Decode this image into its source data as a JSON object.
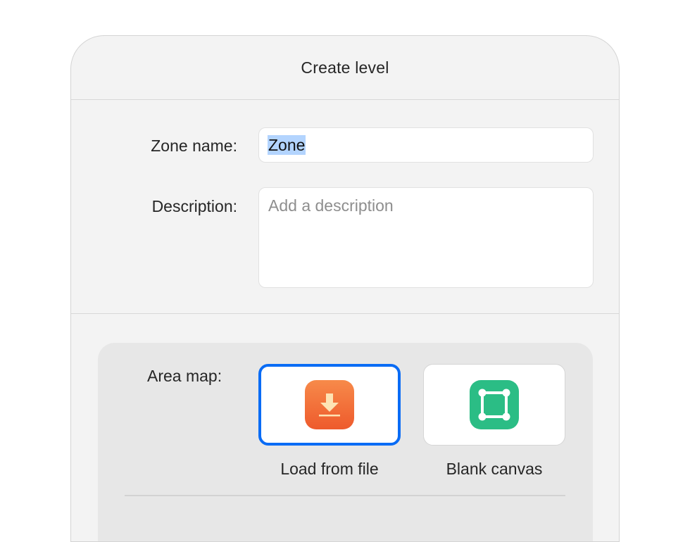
{
  "dialog": {
    "title": "Create level"
  },
  "form": {
    "zone_name": {
      "label": "Zone name:",
      "value": "Zone"
    },
    "description": {
      "label": "Description:",
      "placeholder": "Add a description",
      "value": ""
    }
  },
  "area_map": {
    "label": "Area map:",
    "options": [
      {
        "label": "Load from file",
        "icon": "download-icon",
        "selected": true
      },
      {
        "label": "Blank canvas",
        "icon": "blank-canvas-icon",
        "selected": false
      }
    ]
  },
  "colors": {
    "accent": "#0a6cf5",
    "load_icon": "#f0652f",
    "blank_icon": "#2bbd85",
    "selection_highlight": "#b3d4fe"
  }
}
